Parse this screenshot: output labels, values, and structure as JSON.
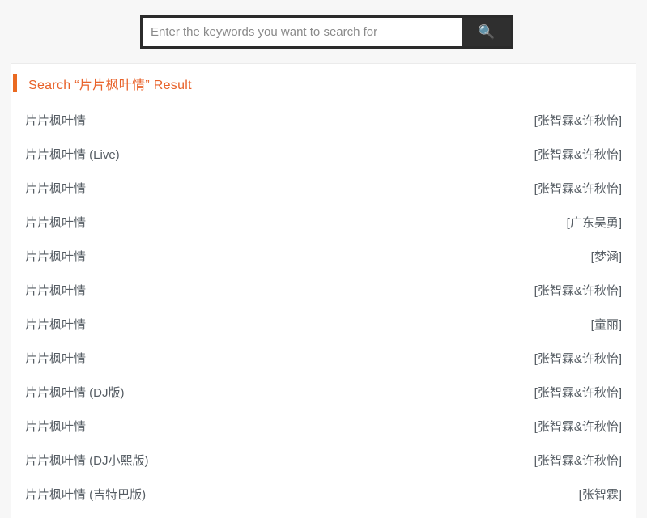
{
  "search": {
    "placeholder": "Enter the keywords you want to search for",
    "value": "",
    "button_icon": "search-icon",
    "button_glyph": "🔍"
  },
  "results_panel": {
    "heading": "Search “片片枫叶情” Result",
    "query": "片片枫叶情",
    "accent_color": "#ea6a21",
    "rows": [
      {
        "title": "片片枫叶情",
        "artist": "[张智霖&许秋怡]"
      },
      {
        "title": "片片枫叶情 (Live)",
        "artist": "[张智霖&许秋怡]"
      },
      {
        "title": "片片枫叶情",
        "artist": "[张智霖&许秋怡]"
      },
      {
        "title": "片片枫叶情",
        "artist": "[广东吴勇]"
      },
      {
        "title": "片片枫叶情",
        "artist": "[梦涵]"
      },
      {
        "title": "片片枫叶情",
        "artist": "[张智霖&许秋怡]"
      },
      {
        "title": "片片枫叶情",
        "artist": "[童丽]"
      },
      {
        "title": "片片枫叶情",
        "artist": "[张智霖&许秋怡]"
      },
      {
        "title": "片片枫叶情 (DJ版)",
        "artist": "[张智霖&许秋怡]"
      },
      {
        "title": "片片枫叶情",
        "artist": "[张智霖&许秋怡]"
      },
      {
        "title": "片片枫叶情 (DJ小熙版)",
        "artist": "[张智霖&许秋怡]"
      },
      {
        "title": "片片枫叶情 (吉特巴版)",
        "artist": "[张智霖]"
      }
    ]
  }
}
